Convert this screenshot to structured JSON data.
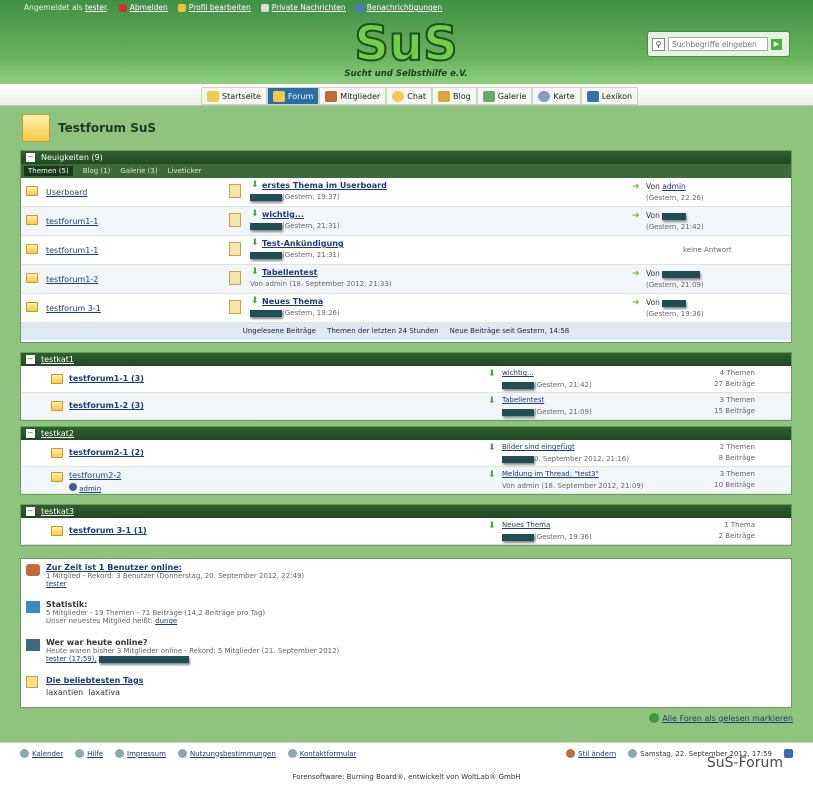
{
  "userbar": {
    "logged_in": "Angemeldet als",
    "user": "tester",
    "logout": "Abmelden",
    "profile": "Profil bearbeiten",
    "pm": "Private Nachrichten",
    "notifications": "Benachrichtigungen"
  },
  "logo": {
    "text": "SuS",
    "tagline": "Sucht und Selbsthilfe e.V."
  },
  "search": {
    "placeholder": "Suchbegriffe eingeben"
  },
  "nav": [
    "Startseite",
    "Forum",
    "Mitglieder",
    "Chat",
    "Blog",
    "Galerie",
    "Karte",
    "Lexikon"
  ],
  "page_title": "Testforum SuS",
  "news": {
    "title": "Neuigkeiten (9)",
    "tabs": [
      "Themen (5)",
      "Blog (1)",
      "Galerie (3)",
      "Liveticker"
    ],
    "rows": [
      {
        "forum": "Userboard",
        "thread": "erstes Thema im Userboard",
        "date": "(Gestern, 19:37)",
        "last_prefix": "Von",
        "last_user": "admin",
        "last_date": "(Gestern, 22:26)"
      },
      {
        "forum": "testforum1-1",
        "thread": "wichtig...",
        "date": "(Gestern, 21:31)",
        "last_prefix": "Von",
        "last_user": "",
        "last_date": "(Gestern, 21:42)"
      },
      {
        "forum": "testforum1-1",
        "thread": "Test-Ankündigung",
        "date": "(Gestern, 21:31)",
        "last_prefix": "",
        "last_user": "",
        "last_date": "keine Antwort"
      },
      {
        "forum": "testforum1-2",
        "thread": "Tabellentest",
        "date": "Von admin (18. September 2012, 21:33)",
        "last_prefix": "Von",
        "last_user": "",
        "last_date": "(Gestern, 21:09)"
      },
      {
        "forum": "testforum 3-1",
        "thread": "Neues Thema",
        "date": "(Gestern, 19:26)",
        "last_prefix": "Von",
        "last_user": "",
        "last_date": "(Gestern, 19:36)"
      }
    ],
    "footer": [
      "Ungelesene Beiträge",
      "Themen der letzten 24 Stunden",
      "Neue Beiträge seit Gestern, 14:58"
    ]
  },
  "cats": [
    {
      "name": "testkat1",
      "forums": [
        {
          "name": "testforum1-1 (3)",
          "last": "wichtig...",
          "date": "(Gestern, 21:42)",
          "topics": "4 Themen",
          "posts": "27 Beiträge"
        },
        {
          "name": "testforum1-2 (3)",
          "last": "Tabellentest",
          "date": "(Gestern, 21:09)",
          "topics": "3 Themen",
          "posts": "15 Beiträge"
        }
      ]
    },
    {
      "name": "testkat2",
      "forums": [
        {
          "name": "testforum2-1 (2)",
          "last": "Bilder sind eingefügt",
          "date": "0. September 2012, 21:16)",
          "topics": "2 Themen",
          "posts": "8 Beiträge"
        },
        {
          "name": "testforum2-2",
          "mod": "admin",
          "last": "Meldung im Thread: \"test3\"",
          "date": "Von admin (18. September 2012, 21:09)",
          "topics": "3 Themen",
          "posts": "10 Beiträge"
        }
      ]
    },
    {
      "name": "testkat3",
      "forums": [
        {
          "name": "testforum 3-1 (1)",
          "last": "Neues Thema",
          "date": "(Gestern, 19:36)",
          "topics": "1 Thema",
          "posts": "2 Beiträge"
        }
      ]
    }
  ],
  "stats": {
    "online_title": "Zur Zeit ist 1 Benutzer online:",
    "online_desc": "1 Mitglied - Rekord: 3 Benutzer (Donnerstag, 20. September 2012, 22:49)",
    "online_user": "tester",
    "stat_title": "Statistik:",
    "stat_desc": "5 Mitglieder - 19 Themen - 71 Beiträge (14,2 Beiträge pro Tag)",
    "stat_newest": "Unser neuestes Mitglied heißt:",
    "stat_newest_user": "dunge",
    "today_title": "Wer war heute online?",
    "today_desc": "Heute waren bisher 3 Mitglieder online - Rekord: 5 Mitglieder (21. September 2012)",
    "today_user": "tester (17:59),",
    "tags_title": "Die beliebtesten Tags",
    "tags": [
      "laxantien",
      "laxativa"
    ]
  },
  "mark_read": "Alle Foren als gelesen markieren",
  "footer": {
    "links": [
      "Kalender",
      "Hilfe",
      "Impressum",
      "Nutzungsbestimmungen",
      "Kontaktformular"
    ],
    "style": "Stil ändern",
    "time": "Samstag, 22. September 2012, 17:59",
    "software": "Forensoftware: Burning Board®, entwickelt von WoltLab® GmbH",
    "brand": "SuS-Forum"
  }
}
